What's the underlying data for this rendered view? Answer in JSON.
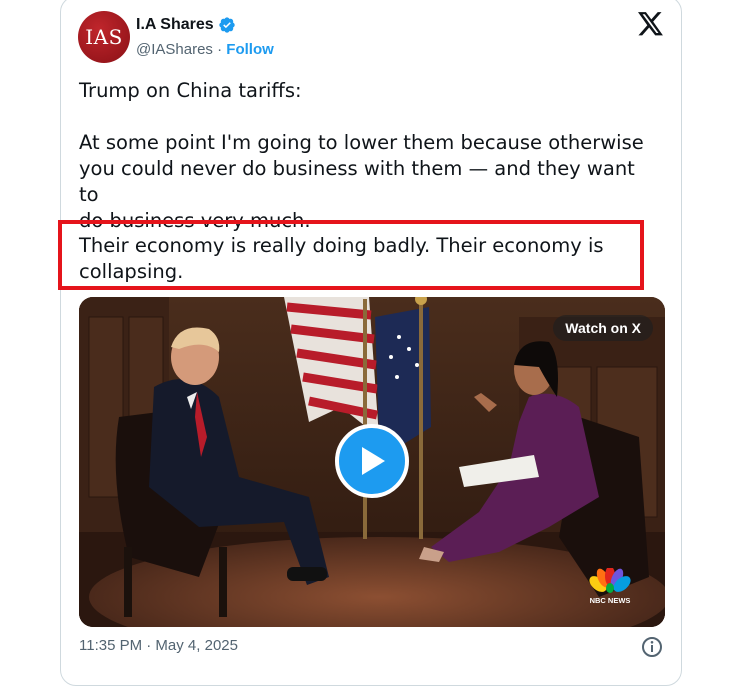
{
  "author": {
    "avatar_text": "IAS",
    "display_name": "I.A Shares",
    "handle": "@IAShares",
    "separator": "·",
    "follow_label": "Follow"
  },
  "tweet": {
    "line1": "Trump on China tariffs:",
    "para2": "At some point I'm going to lower them because otherwise\nyou could never do business with them — and they want to\ndo business very much.",
    "highlighted": "Their economy is really doing badly. Their economy is\ncollapsing."
  },
  "video": {
    "watch_label": "Watch on X",
    "nbc_label": "NBC NEWS"
  },
  "footer": {
    "timestamp": "11:35 PM · May 4, 2025"
  },
  "colors": {
    "accent": "#1d9bf0",
    "highlight": "#e5141b",
    "avatar": "#a8181e"
  }
}
